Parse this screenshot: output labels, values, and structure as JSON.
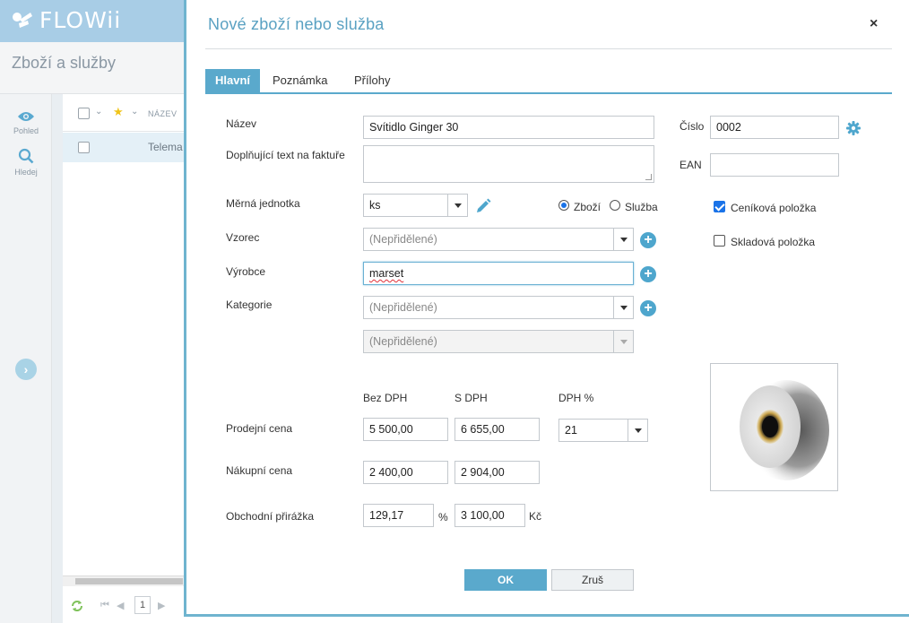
{
  "app": {
    "brand": "FLOWii",
    "page_title": "Zboží a služby",
    "rail": [
      {
        "label": "Pohled",
        "icon": "eye-icon"
      },
      {
        "label": "Hledej",
        "icon": "search-icon"
      }
    ],
    "list": {
      "name_header": "NÁZEV",
      "row_text": "Telema",
      "page_number": "1"
    }
  },
  "modal": {
    "title": "Nové zboží nebo služba",
    "close": "×",
    "tabs": [
      {
        "label": "Hlavní",
        "active": true
      },
      {
        "label": "Poznámka",
        "active": false
      },
      {
        "label": "Přílohy",
        "active": false
      }
    ],
    "fields": {
      "name_label": "Název",
      "name_value": "Svítidlo Ginger 30",
      "extra_text_label": "Doplňující text na faktuře",
      "extra_text_value": "",
      "unit_label": "Měrná jednotka",
      "unit_value": "ks",
      "type_goods": "Zboží",
      "type_service": "Služba",
      "type_selected": "Zboží",
      "formula_label": "Vzorec",
      "formula_value": "(Nepřidělené)",
      "maker_label": "Výrobce",
      "maker_value": "marset",
      "category_label": "Kategorie",
      "category_value": "(Nepřidělené)",
      "subcategory_value": "(Nepřidělené)",
      "number_label": "Číslo",
      "number_value": "0002",
      "ean_label": "EAN",
      "ean_value": "",
      "pricelist_item": "Ceníková položka",
      "pricelist_checked": true,
      "stock_item": "Skladová položka",
      "stock_checked": false
    },
    "prices": {
      "col_no_vat": "Bez DPH",
      "col_with_vat": "S DPH",
      "col_vat_pct": "DPH %",
      "sale_label": "Prodejní cena",
      "sale_no_vat": "5 500,00",
      "sale_with_vat": "6 655,00",
      "vat_pct": "21",
      "purchase_label": "Nákupní cena",
      "purchase_no_vat": "2 400,00",
      "purchase_with_vat": "2 904,00",
      "markup_label": "Obchodní přirážka",
      "markup_pct": "129,17",
      "markup_pct_unit": "%",
      "markup_amount": "3 100,00",
      "markup_currency": "Kč"
    },
    "buttons": {
      "ok": "OK",
      "cancel": "Zruš"
    }
  },
  "colors": {
    "accent": "#5aa9cc",
    "header_bg": "#a8cde6"
  }
}
